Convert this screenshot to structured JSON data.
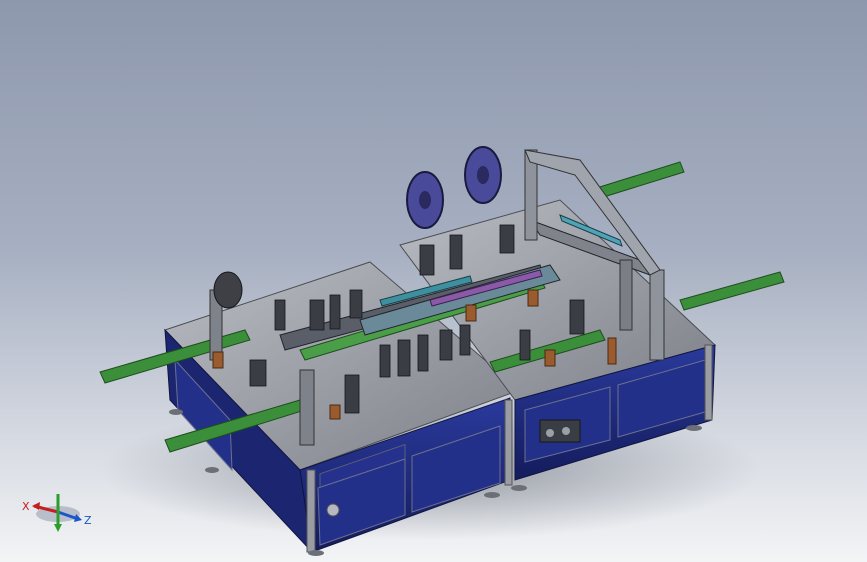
{
  "viewport": {
    "background_top": "#8e98ad",
    "background_bottom": "#f3f4f6",
    "model_colors": {
      "frame_blue": "#1f2b7a",
      "plate_gray": "#8a8c93",
      "green_conveyor": "#3b8f3a",
      "purple_reel": "#4a4a9a",
      "dark_parts": "#3a3d44",
      "copper": "#9a5b2e"
    }
  },
  "triad": {
    "x_label": "X",
    "z_label": "Z",
    "x_color": "#c61d1d",
    "y_color": "#2a9d2a",
    "z_color": "#1a56c9"
  }
}
